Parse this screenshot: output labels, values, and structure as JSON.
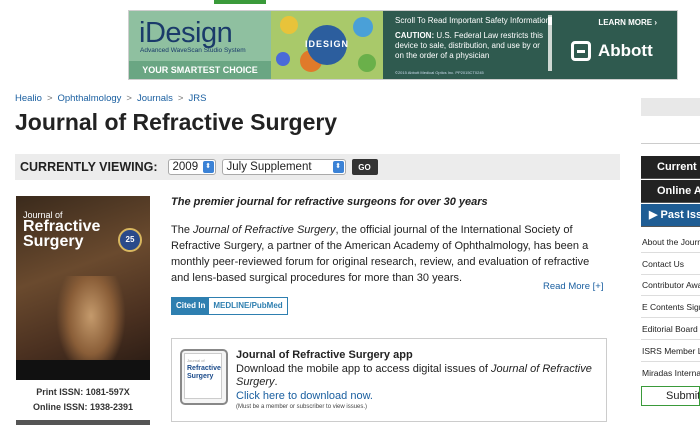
{
  "ad": {
    "brand": "iDesign",
    "subtitle": "Advanced WaveScan Studio System",
    "tagline": "YOUR SMARTEST CHOICE",
    "middle_word": "IDESIGN",
    "scroll_text": "Scroll To Read Important Safety Information",
    "caution_label": "CAUTION:",
    "caution_text": "U.S. Federal Law restricts this device to sale, distribution, and use by or on the order of a physician",
    "fine_print": "©2015 Abbott Medical Optics Inc. PP2015CT0245",
    "learn_more": "LEARN MORE ›",
    "sponsor": "Abbott"
  },
  "breadcrumb": [
    {
      "label": "Healio"
    },
    {
      "label": "Ophthalmology"
    },
    {
      "label": "Journals"
    },
    {
      "label": "JRS"
    }
  ],
  "breadcrumb_separator": ">",
  "page_title": "Journal of Refractive Surgery",
  "viewing": {
    "label": "CURRENTLY VIEWING:",
    "year": "2009",
    "issue": "July Supplement",
    "go": "GO"
  },
  "cover": {
    "journal_of": "Journal of",
    "name_line1": "Refractive",
    "name_line2": "Surgery",
    "badge": "25"
  },
  "issn": {
    "print": "Print ISSN: 1081-597X",
    "online": "Online ISSN: 1938-2391"
  },
  "about": {
    "tagline": "The premier journal for refractive surgeons for over 30 years",
    "pre": "The ",
    "journal": "Journal of Refractive Surgery",
    "post": ", the official journal of the International Society of Refractive Surgery, a partner of the American Academy of Ophthalmology, has been a monthly peer-reviewed forum for original research, review, and evaluation of refractive and lens-based surgical procedures for more than 30 years.",
    "read_more": "Read More [+]"
  },
  "cited": {
    "label": "Cited In",
    "value": "MEDLINE/PubMed"
  },
  "app": {
    "icon_line1": "Refractive",
    "icon_line2": "Surgery",
    "title": "Journal of Refractive Surgery app",
    "desc_pre": "Download the mobile app to access digital issues of ",
    "desc_journal": "Journal of Refractive Surgery",
    "desc_post": ".",
    "link": "Click here to download now.",
    "note": "(Must be a member or subscriber to view issues.)"
  },
  "sidebar": {
    "buttons": [
      "Current Issue",
      "Online Ahead of Print",
      "Past Issues"
    ],
    "links": [
      "About the Journal",
      "Contact Us",
      "Contributor Awards",
      "E Contents Sign-Up",
      "Editorial Board",
      "ISRS Member Login",
      "Miradas Internacionales"
    ],
    "submit": "Submit"
  }
}
